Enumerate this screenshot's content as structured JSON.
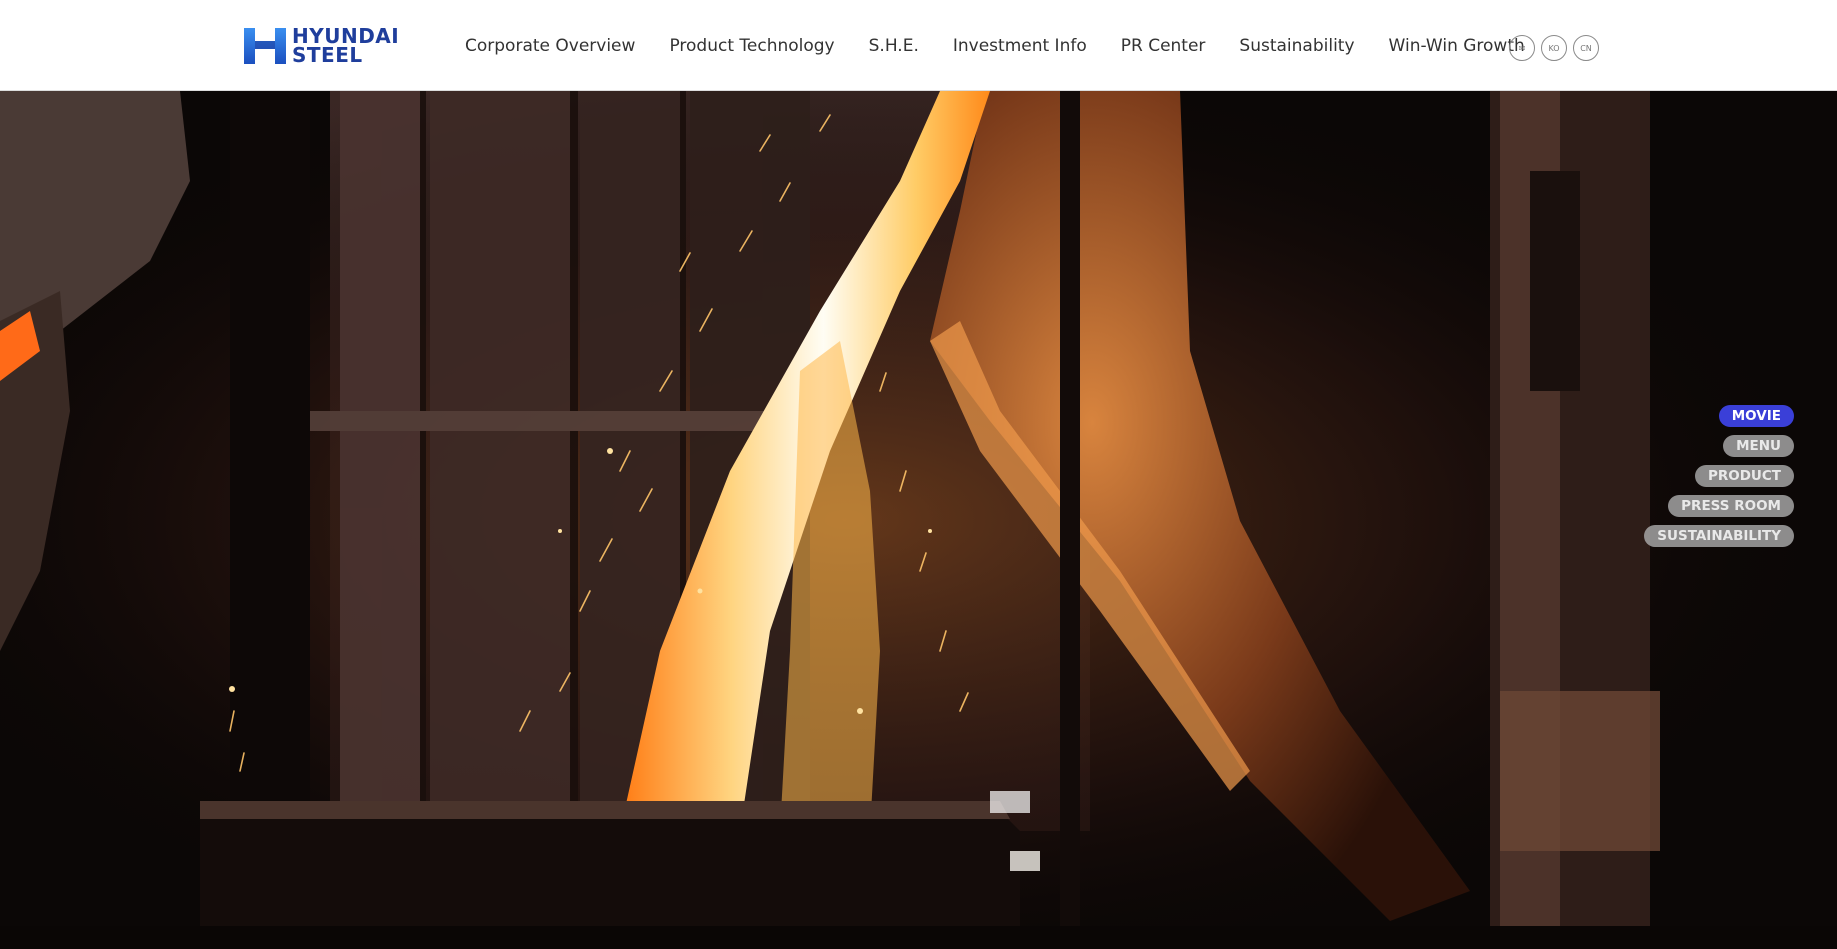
{
  "header": {
    "logo": {
      "line1": "HYUNDAI",
      "line2": "STEEL"
    },
    "nav": [
      {
        "label": "Corporate Overview"
      },
      {
        "label": "Product Technology"
      },
      {
        "label": "S.H.E."
      },
      {
        "label": "Investment Info"
      },
      {
        "label": "PR Center"
      },
      {
        "label": "Sustainability"
      },
      {
        "label": "Win-Win Growth"
      }
    ],
    "utilities": [
      {
        "icon": "mail-icon",
        "label": "✉"
      },
      {
        "icon": "language-ko-icon",
        "label": "KO"
      },
      {
        "icon": "language-cn-icon",
        "label": "CN"
      }
    ]
  },
  "hero": {
    "media": "video",
    "scene": "molten steel pouring with sparks"
  },
  "side_nav": {
    "items": [
      {
        "label": "MOVIE",
        "active": true
      },
      {
        "label": "MENU",
        "active": false
      },
      {
        "label": "PRODUCT",
        "active": false
      },
      {
        "label": "PRESS ROOM",
        "active": false
      },
      {
        "label": "SUSTAINABILITY",
        "active": false
      }
    ]
  },
  "colors": {
    "brand": "#1f3e9c",
    "active": "#3a3fd8",
    "inactive": "#aaaaaa"
  }
}
